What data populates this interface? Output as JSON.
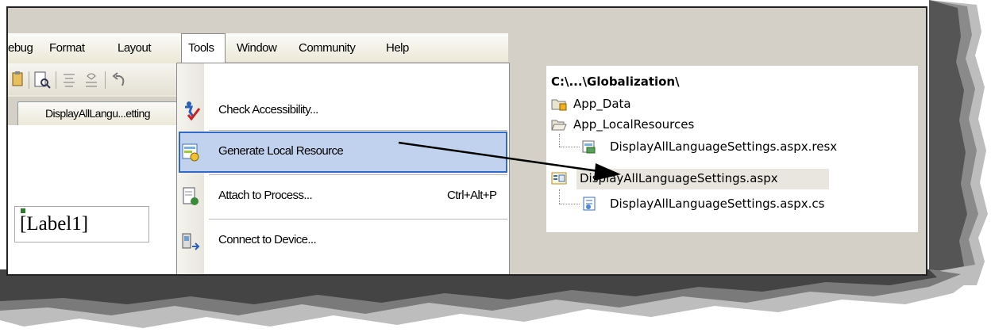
{
  "menubar": {
    "items": [
      "ebug",
      "Format",
      "Layout",
      "Tools",
      "Window",
      "Community",
      "Help"
    ],
    "active": "Tools"
  },
  "document_tab": {
    "label": "DisplayAllLangu...etting"
  },
  "designer": {
    "label_control_text": "[Label1]"
  },
  "tools_menu": {
    "items": [
      {
        "label": "Check Accessibility...",
        "shortcut": "",
        "icon": "accessibility-check-icon"
      },
      {
        "label": "Generate Local Resource",
        "shortcut": "",
        "icon": "generate-resource-icon",
        "highlighted": true
      },
      {
        "label": "Attach to Process...",
        "shortcut": "Ctrl+Alt+P",
        "icon": "attach-process-icon"
      },
      {
        "label": "Connect to Device...",
        "shortcut": "",
        "icon": "connect-device-icon"
      }
    ]
  },
  "solution_explorer": {
    "root": "C:\\...\\Globalization\\",
    "items": [
      {
        "label": "App_Data",
        "icon": "special-folder-icon"
      },
      {
        "label": "App_LocalResources",
        "icon": "open-folder-icon"
      },
      {
        "label": "DisplayAllLanguageSettings.aspx.resx",
        "icon": "resx-file-icon"
      },
      {
        "label": "DisplayAllLanguageSettings.aspx",
        "icon": "aspx-file-icon",
        "selected": true
      },
      {
        "label": "DisplayAllLanguageSettings.aspx.cs",
        "icon": "cs-file-icon"
      }
    ]
  },
  "colors": {
    "menu_highlight": "#c1d2ee",
    "menu_highlight_border": "#316ac5",
    "frame_gray": "#d4d0c8"
  }
}
